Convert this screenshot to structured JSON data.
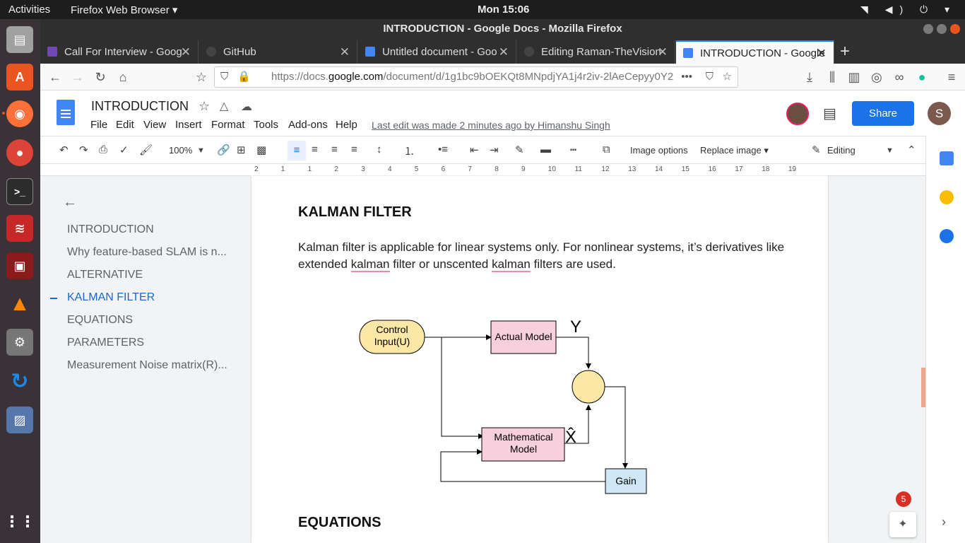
{
  "topbar": {
    "activities": "Activities",
    "app_menu": "Firefox Web Browser ▾",
    "clock": "Mon 15:06",
    "tray": "◥ ◀) ⏻ ▾"
  },
  "window": {
    "title": "INTRODUCTION - Google Docs - Mozilla Firefox"
  },
  "tabs": [
    {
      "label": "Call For Interview - Goog",
      "color": "#7248b9"
    },
    {
      "label": "GitHub",
      "color": "#444444"
    },
    {
      "label": "Untitled document - Goo",
      "color": "#4285f4"
    },
    {
      "label": "Editing Raman-TheVision",
      "color": "#444444"
    },
    {
      "label": "INTRODUCTION - Google",
      "color": "#4285f4"
    }
  ],
  "new_tab": "+",
  "url": {
    "prefix": "https://docs.",
    "domain": "google.com",
    "path": "/document/d/1g1bc9bOEKQt8MNpdjYA1j4r2iv-2lAeCepyy0Y2"
  },
  "docs": {
    "title": "INTRODUCTION",
    "menus": [
      "File",
      "Edit",
      "View",
      "Insert",
      "Format",
      "Tools",
      "Add-ons",
      "Help"
    ],
    "last_edit": "Last edit was made 2 minutes ago by Himanshu Singh",
    "share": "Share",
    "user_initial": "S"
  },
  "toolbar": {
    "zoom": "100%",
    "image_options": "Image options",
    "replace_image": "Replace image ▾",
    "mode": "Editing"
  },
  "ruler_marks": [
    "2",
    "1",
    "1",
    "2",
    "3",
    "4",
    "5",
    "6",
    "7",
    "8",
    "9",
    "10",
    "11",
    "12",
    "13",
    "14",
    "15",
    "16",
    "17",
    "18",
    "19"
  ],
  "outline": {
    "items": [
      "INTRODUCTION",
      "Why feature-based SLAM is n...",
      "ALTERNATIVE",
      "KALMAN FILTER",
      "EQUATIONS",
      "PARAMETERS",
      "Measurement Noise matrix(R)..."
    ],
    "active_index": 3
  },
  "content": {
    "heading1": "KALMAN FILTER",
    "para_part1": "Kalman filter is applicable for linear systems only. For nonlinear systems, it’s derivatives like extended ",
    "spell1": "kalman",
    "para_part2": " filter or unscented ",
    "spell2": "kalman",
    "para_part3": " filters are used.",
    "heading2": "EQUATIONS"
  },
  "diagram": {
    "control_line1": "Control",
    "control_line2": "Input(U)",
    "actual_model": "Actual Model",
    "math_line1": "Mathematical",
    "math_line2": "Model",
    "y_label": "Y",
    "xhat_label": "X̂",
    "gain": "Gain"
  },
  "notifications": {
    "count": "5"
  }
}
